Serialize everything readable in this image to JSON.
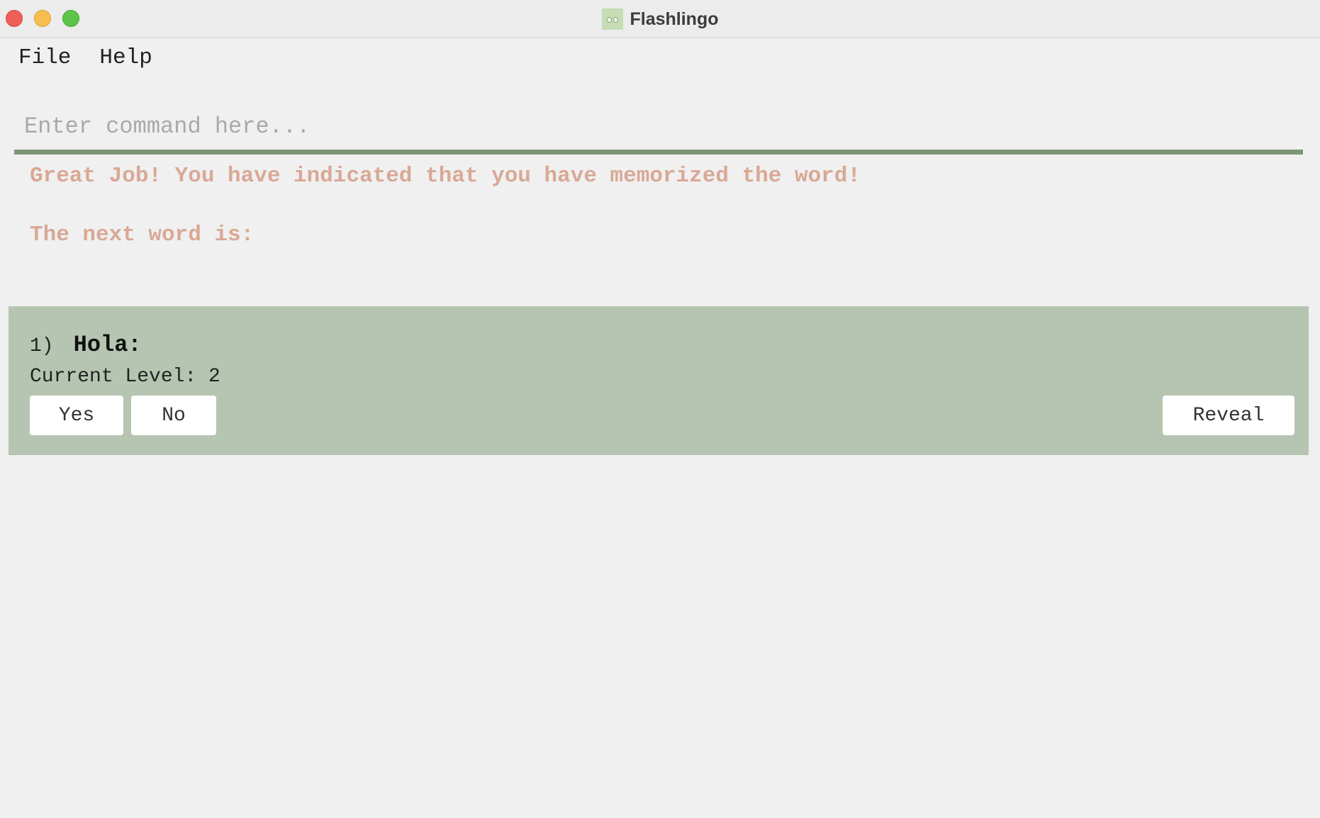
{
  "window": {
    "title": "Flashlingo"
  },
  "menu": {
    "items": [
      {
        "label": "File"
      },
      {
        "label": "Help"
      }
    ]
  },
  "command": {
    "placeholder": "Enter command here...",
    "value": ""
  },
  "result": {
    "line1": "Great Job! You have indicated that you have memorized the word!",
    "line2": "The next word is:"
  },
  "card": {
    "index": "1)",
    "word": "Hola:",
    "level": "Current Level: 2",
    "yes_label": "Yes",
    "no_label": "No",
    "reveal_label": "Reveal"
  },
  "colors": {
    "background": "#f0f0f0",
    "accent_line": "#7e9476",
    "result_text": "#d9a895",
    "card_background": "#b5c5b1",
    "button_background": "#ffffff"
  }
}
